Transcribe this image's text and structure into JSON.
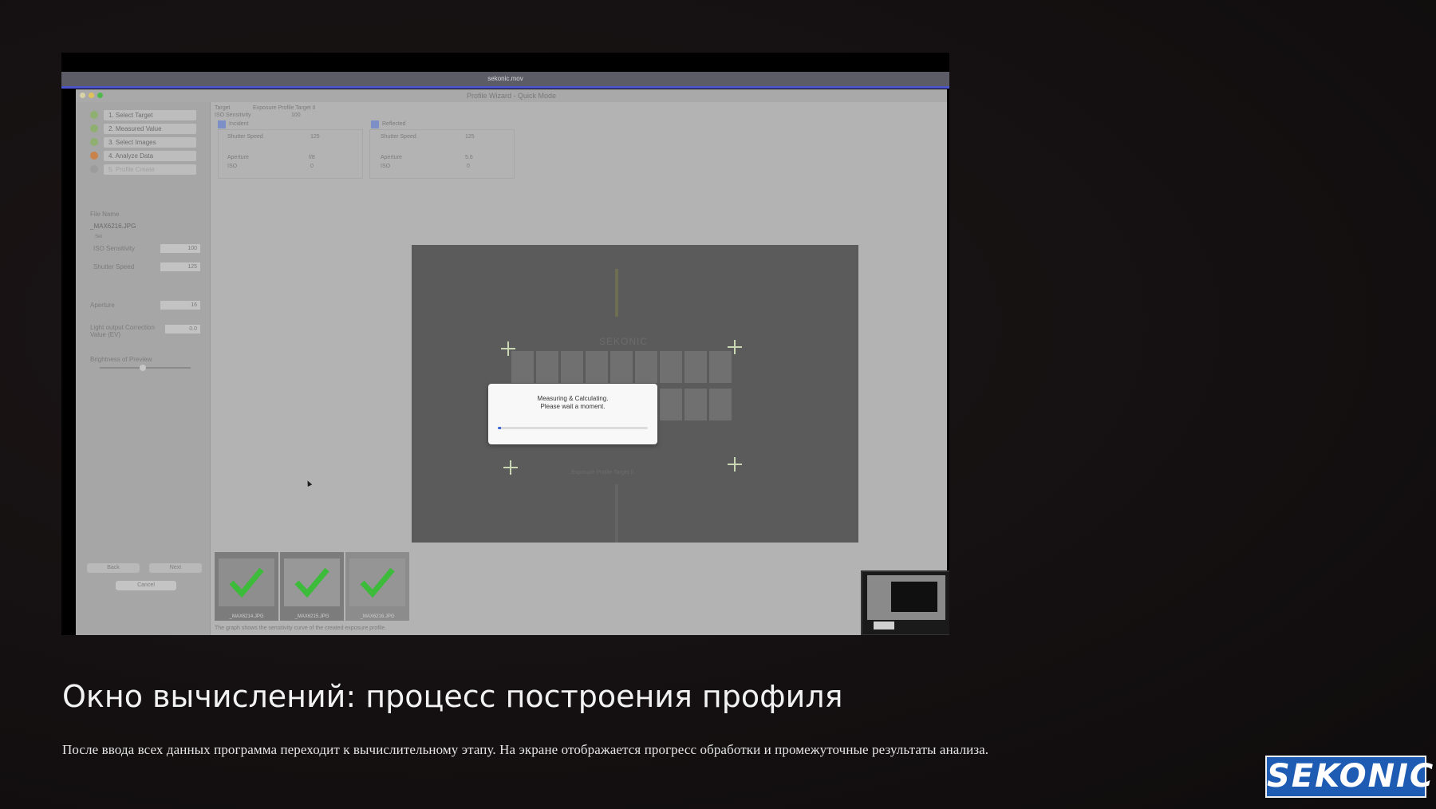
{
  "screenshot": {
    "menubar_title": "sekonic.mov",
    "window_title": "Profile Wizard - Quick Mode",
    "sidebar": {
      "steps": [
        {
          "label": "1. Select Target",
          "status": "done",
          "color": "#8fb070"
        },
        {
          "label": "2. Measured Value",
          "status": "done",
          "color": "#8fb070"
        },
        {
          "label": "3. Select Images",
          "status": "done",
          "color": "#8fb070"
        },
        {
          "label": "4. Analyze Data",
          "status": "current",
          "color": "#c9834a"
        },
        {
          "label": "5. Profile Create",
          "status": "pending",
          "color": "#9c9c9c"
        }
      ],
      "file_name_label": "File Name",
      "file_name_value": "_MAX6216.JPG",
      "set_label": "Set",
      "iso_label": "ISO Sensitivity",
      "iso_value": "100",
      "shutter_label": "Shutter Speed",
      "shutter_value": "125",
      "aperture_label": "Aperture",
      "aperture_value": "16",
      "light_output_label": "Light output Correction Value (EV)",
      "light_output_value": "0.0",
      "brightness_label": "Brightness of Preview",
      "back_button": "Back",
      "next_button": "Next",
      "cancel_button": "Cancel"
    },
    "top_panel": {
      "target_label": "Target",
      "target_value": "Exposure Profile Target II",
      "iso_label": "ISO Sensitivity",
      "iso_value": "100",
      "incident_label": "Incident",
      "reflected_label": "Reflected",
      "incident_shutter_label": "Shutter Speed",
      "incident_shutter_value": "125",
      "reflected_shutter_label": "Shutter Speed",
      "reflected_shutter_value": "125",
      "incident_aperture_label": "Aperture",
      "incident_aperture_value": "f/8",
      "reflected_aperture_label": "Aperture",
      "reflected_aperture_value": "5.6",
      "incident_iso": "ISO",
      "incident_iso_num": "0",
      "reflected_iso": "ISO",
      "reflected_iso_num": "0"
    },
    "viewer": {
      "brand_text": "SEKONIC",
      "caption": "Exposure Profile Target II"
    },
    "dialog": {
      "line1": "Measuring & Calculating.",
      "line2": "Please wait a moment.",
      "progress_fraction": 0.02,
      "progress_color": "#3b6ad6"
    },
    "thumbnails": [
      {
        "name": "_MAX6214.JPG"
      },
      {
        "name": "_MAX6215.JPG"
      },
      {
        "name": "_MAX6216.JPG"
      }
    ],
    "graph_note": "The graph shows the sensitivity curve of the created exposure profile."
  },
  "slide": {
    "heading": "Окно вычислений: процесс построения профиля",
    "description": "После ввода всех данных программа переходит к вычислительному этапу. На экране отображается прогресс обработки и промежуточные результаты анализа.",
    "logo_text": "SEKONIC",
    "logo_color": "#1e5cb3"
  }
}
